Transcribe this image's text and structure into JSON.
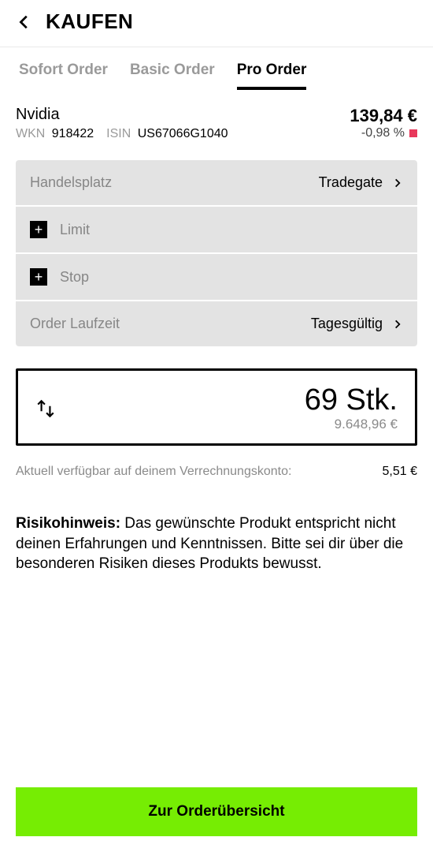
{
  "header": {
    "title": "KAUFEN"
  },
  "tabs": [
    {
      "label": "Sofort Order",
      "active": false
    },
    {
      "label": "Basic Order",
      "active": false
    },
    {
      "label": "Pro Order",
      "active": true
    }
  ],
  "stock": {
    "name": "Nvidia",
    "wkn_label": "WKN",
    "wkn_value": "918422",
    "isin_label": "ISIN",
    "isin_value": "US67066G1040",
    "price": "139,84 €",
    "change": "-0,98 %"
  },
  "settings": {
    "handelsplatz_label": "Handelsplatz",
    "handelsplatz_value": "Tradegate",
    "limit_label": "Limit",
    "stop_label": "Stop",
    "laufzeit_label": "Order Laufzeit",
    "laufzeit_value": "Tagesgültig"
  },
  "quantity": {
    "value": "69 Stk.",
    "total": "9.648,96 €"
  },
  "balance": {
    "label": "Aktuell verfügbar auf deinem Verrechnungskonto:",
    "value": "5,51 €"
  },
  "risk": {
    "label": "Risikohinweis:",
    "text": " Das gewünschte Produkt entspricht nicht deinen Erfahrungen und Kenntnissen. Bitte sei dir über die besonderen Risiken dieses Produkts bewusst."
  },
  "cta": {
    "label": "Zur Orderübersicht"
  }
}
